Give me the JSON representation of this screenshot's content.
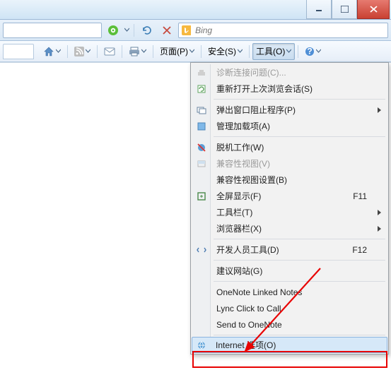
{
  "search": {
    "placeholder": "Bing"
  },
  "toolbar": {
    "page_label": "页面(P)",
    "safety_label": "安全(S)",
    "tools_label": "工具(O)"
  },
  "menu": {
    "diagnose": "诊断连接问题(C)...",
    "reopen": "重新打开上次浏览会话(S)",
    "popup": "弹出窗口阻止程序(P)",
    "addons": "管理加载项(A)",
    "offline": "脱机工作(W)",
    "compat_view": "兼容性视图(V)",
    "compat_settings": "兼容性视图设置(B)",
    "fullscreen": "全屏显示(F)",
    "fullscreen_key": "F11",
    "toolbars": "工具栏(T)",
    "explorer_bars": "浏览器栏(X)",
    "devtools": "开发人员工具(D)",
    "devtools_key": "F12",
    "suggested": "建议网站(G)",
    "onenote_linked": "OneNote Linked Notes",
    "lync": "Lync Click to Call",
    "send_onenote": "Send to OneNote",
    "internet_options": "Internet 选项(O)"
  }
}
